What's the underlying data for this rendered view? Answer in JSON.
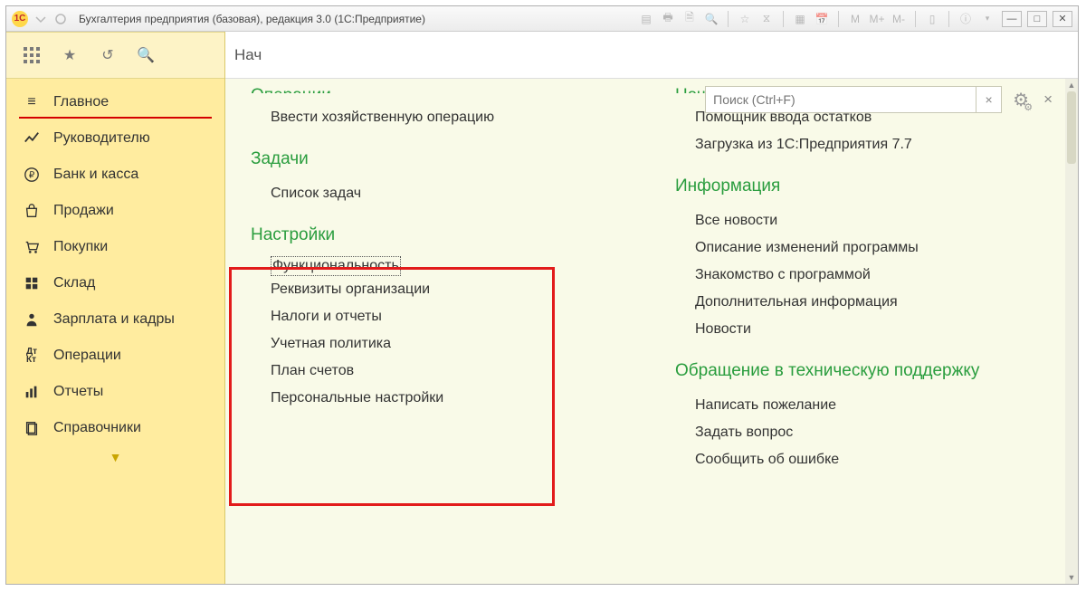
{
  "titlebar": {
    "logo": "1С",
    "title": "Бухгалтерия предприятия (базовая), редакция 3.0  (1С:Предприятие)",
    "m_items": [
      "M",
      "M+",
      "M-"
    ]
  },
  "subheader": {
    "stub": "Нач"
  },
  "search": {
    "placeholder": "Поиск (Ctrl+F)"
  },
  "sidebar": {
    "items": [
      {
        "label": "Главное",
        "icon": "menu-icon",
        "active": true
      },
      {
        "label": "Руководителю",
        "icon": "trend-icon"
      },
      {
        "label": "Банк и касса",
        "icon": "ruble-icon"
      },
      {
        "label": "Продажи",
        "icon": "bag-icon"
      },
      {
        "label": "Покупки",
        "icon": "cart-icon"
      },
      {
        "label": "Склад",
        "icon": "boxes-icon"
      },
      {
        "label": "Зарплата и кадры",
        "icon": "person-icon"
      },
      {
        "label": "Операции",
        "icon": "dtkt-icon"
      },
      {
        "label": "Отчеты",
        "icon": "chart-icon"
      },
      {
        "label": "Справочники",
        "icon": "docs-icon"
      }
    ]
  },
  "left_col": {
    "cut_title": "Операции",
    "op_link": "Ввести хозяйственную операцию",
    "tasks_title": "Задачи",
    "tasks_link": "Список задач",
    "settings_title": "Настройки",
    "settings_links": [
      "Функциональность",
      "Реквизиты организации",
      "Налоги и отчеты",
      "Учетная политика",
      "План счетов",
      "Персональные настройки"
    ]
  },
  "right_col": {
    "cut_title": "Начало работы",
    "start_links": [
      "Помощник ввода остатков",
      "Загрузка из 1С:Предприятия 7.7"
    ],
    "info_title": "Информация",
    "info_links": [
      "Все новости",
      "Описание изменений программы",
      "Знакомство с программой",
      "Дополнительная информация",
      "Новости"
    ],
    "support_title": "Обращение в техническую поддержку",
    "support_links": [
      "Написать пожелание",
      "Задать вопрос",
      "Сообщить об ошибке"
    ]
  }
}
